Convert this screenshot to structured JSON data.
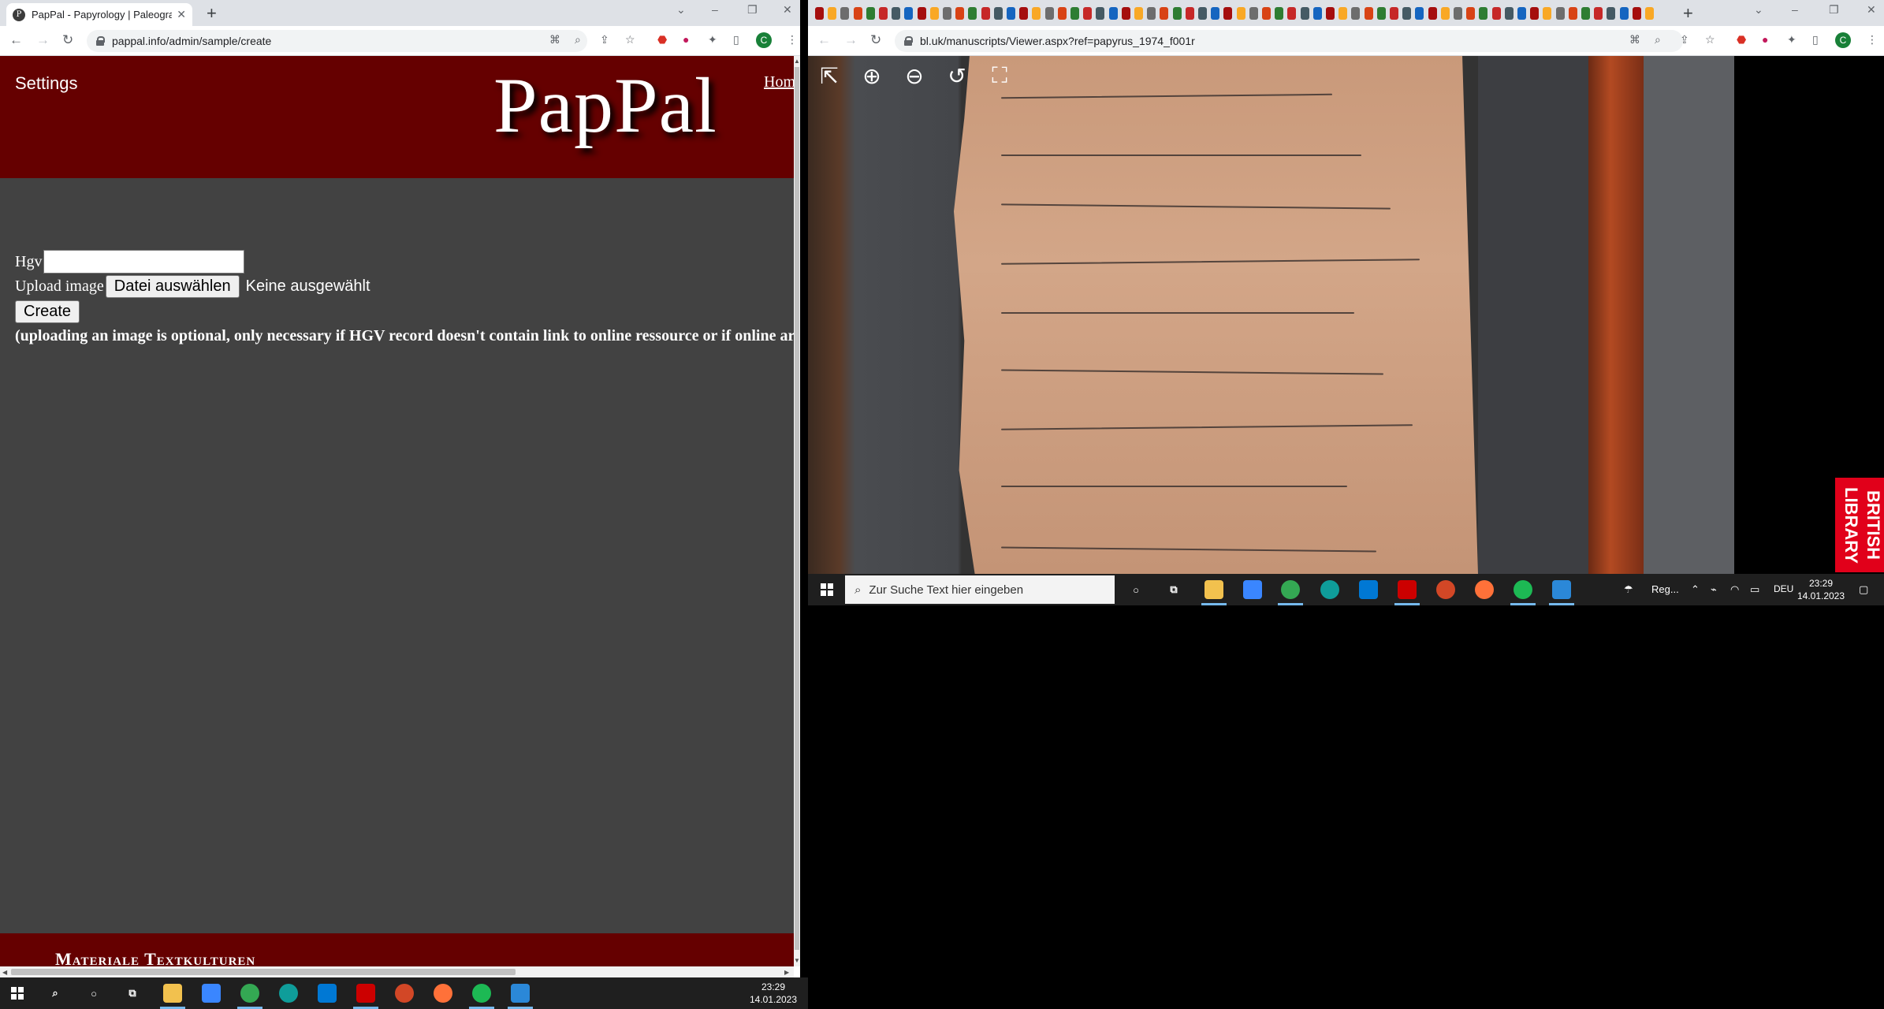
{
  "left_browser": {
    "tab_title": "PapPal - Papyrology | Paleograph",
    "favicon_letter": "P",
    "url": "pappal.info/admin/sample/create",
    "profile_initial": "C"
  },
  "pappal_page": {
    "settings_label": "Settings",
    "logo_text": "PapPal",
    "home_link": "Home",
    "hgv_label": "Hgv",
    "upload_label": "Upload image",
    "file_button_label": "Datei auswählen",
    "no_file_text": "Keine ausgewählt",
    "create_button_label": "Create",
    "note_text": "(uploading an image is optional, only necessary if HGV record doesn't contain link to online ressource or if online archive",
    "footer_title": "Materiale Textkulturen"
  },
  "right_browser": {
    "url": "bl.uk/manuscripts/Viewer.aspx?ref=papyrus_1974_f001r",
    "profile_initial": "C",
    "badge_text": "BRITISH LIBRARY"
  },
  "right_taskbar": {
    "search_placeholder": "Zur Suche Text hier eingeben",
    "weather_label": "Reg...",
    "language": "DEU",
    "time": "23:29",
    "date": "14.01.2023"
  },
  "left_taskbar": {
    "time": "23:29",
    "date": "14.01.2023"
  },
  "icons": [
    "back-icon",
    "forward-icon",
    "reload-icon",
    "lock-icon",
    "translate-icon",
    "zoom-icon",
    "share-icon",
    "star-icon",
    "extension-icon",
    "sidepanel-icon",
    "menu-icon",
    "exit-icon",
    "zoom-in-icon",
    "zoom-out-icon",
    "rotate-icon",
    "fullscreen-icon",
    "windows-start-icon",
    "search-icon",
    "cortana-icon",
    "task-view-icon"
  ]
}
